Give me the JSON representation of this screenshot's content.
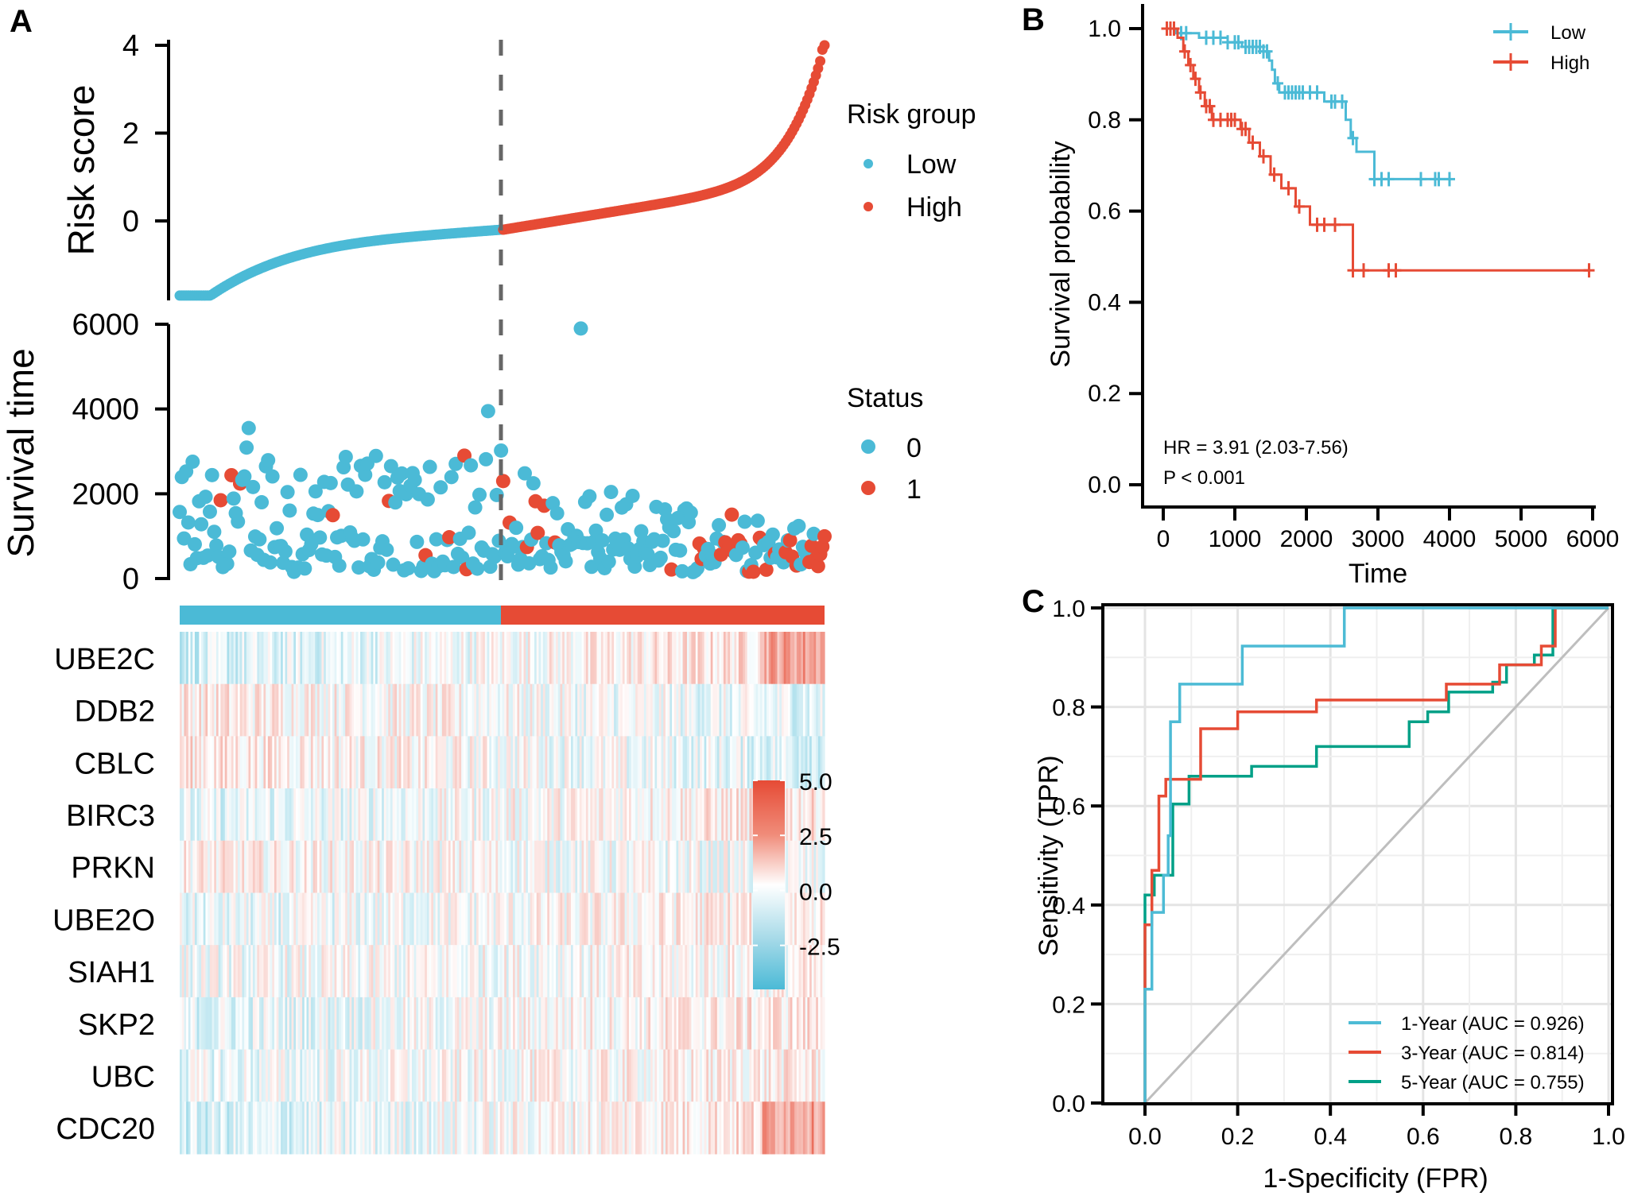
{
  "colors": {
    "low": "#4BBAD6",
    "high": "#E64B35",
    "roc_1y": "#4DBBD5",
    "roc_3y": "#E64B35",
    "roc_5y": "#00A087",
    "diagonal": "#BEBEBE",
    "dashed_cutoff": "#666666"
  },
  "panels": {
    "A": "A",
    "B": "B",
    "C": "C"
  },
  "chart_data": [
    {
      "id": "risk-score",
      "type": "scatter",
      "title": "",
      "ylabel": "Risk score",
      "xlabel": "",
      "ylim": [
        -1.75,
        4.0
      ],
      "yticks": [
        "4",
        "2",
        "0"
      ],
      "ytick_values": [
        4,
        2,
        0
      ],
      "n_patients": 300,
      "cutoff_index": 150,
      "description": "Patients sorted by ascending risk score; low group ranges ~-1.7 to -0.2, high group ranges ~-0.2 to 4.0",
      "series": [
        {
          "name": "Low",
          "x_range": [
            1,
            150
          ],
          "y_start": -1.7,
          "y_end": -0.2
        },
        {
          "name": "High",
          "x_range": [
            151,
            300
          ],
          "y_start": -0.2,
          "y_end": 4.0
        }
      ],
      "legend": {
        "title": "Risk group",
        "entries": [
          "Low",
          "High"
        ],
        "position": "right"
      }
    },
    {
      "id": "survival-time",
      "type": "scatter",
      "ylabel": "Survival time",
      "ylim": [
        0,
        6000
      ],
      "yticks": [
        "6000",
        "4000",
        "2000",
        "0"
      ],
      "ytick_values": [
        6000,
        4000,
        2000,
        0
      ],
      "legend": {
        "title": "Status",
        "entries": [
          "0",
          "1"
        ],
        "position": "right"
      },
      "notable_points": [
        {
          "rank": 186,
          "time": 5900,
          "status": 0
        },
        {
          "rank": 143,
          "time": 3950,
          "status": 0
        },
        {
          "rank": 32,
          "time": 3550,
          "status": 0
        },
        {
          "rank": 132,
          "time": 2900,
          "status": 1
        },
        {
          "rank": 150,
          "time": 2300,
          "status": 1
        }
      ],
      "description": "Survival time per patient ordered by risk score; deaths (status 1) concentrate at the high-risk end"
    },
    {
      "id": "heatmap",
      "type": "heatmap",
      "rows": [
        "UBE2C",
        "DDB2",
        "CBLC",
        "BIRC3",
        "PRKN",
        "UBE2O",
        "SIAH1",
        "SKP2",
        "UBC",
        "CDC20"
      ],
      "row_trend": [
        0.9,
        -0.5,
        -0.6,
        0.6,
        -0.3,
        0.5,
        0.2,
        0.6,
        0.4,
        0.9
      ],
      "annotation_bar": [
        "Low",
        "High"
      ],
      "colorbar": {
        "ticks": [
          "5.0",
          "2.5",
          "0.0",
          "-2.5"
        ],
        "values": [
          5.0,
          2.5,
          0.0,
          -2.5
        ],
        "range": [
          -4.5,
          5.0
        ]
      }
    },
    {
      "id": "km-curve",
      "type": "line",
      "xlabel": "Time",
      "ylabel": "Survival probability",
      "xlim": [
        0,
        6000
      ],
      "ylim": [
        0,
        1.0
      ],
      "xticks": [
        "0",
        "1000",
        "2000",
        "3000",
        "4000",
        "5000",
        "6000"
      ],
      "xtick_values": [
        0,
        1000,
        2000,
        3000,
        4000,
        5000,
        6000
      ],
      "yticks": [
        "1.0",
        "0.8",
        "0.6",
        "0.4",
        "0.2",
        "0.0"
      ],
      "ytick_values": [
        1.0,
        0.8,
        0.6,
        0.4,
        0.2,
        0.0
      ],
      "annotations": [
        "HR = 3.91 (2.03-7.56)",
        "P < 0.001"
      ],
      "legend": {
        "entries": [
          "Low",
          "High"
        ],
        "position": "top-right"
      },
      "series": [
        {
          "name": "Low",
          "steps": [
            [
              0,
              1.0
            ],
            [
              180,
              1.0
            ],
            [
              180,
              0.99
            ],
            [
              500,
              0.99
            ],
            [
              500,
              0.98
            ],
            [
              900,
              0.98
            ],
            [
              900,
              0.97
            ],
            [
              1100,
              0.97
            ],
            [
              1100,
              0.96
            ],
            [
              1400,
              0.96
            ],
            [
              1400,
              0.95
            ],
            [
              1480,
              0.95
            ],
            [
              1480,
              0.93
            ],
            [
              1520,
              0.93
            ],
            [
              1520,
              0.91
            ],
            [
              1560,
              0.91
            ],
            [
              1560,
              0.88
            ],
            [
              1620,
              0.88
            ],
            [
              1620,
              0.86
            ],
            [
              2250,
              0.86
            ],
            [
              2250,
              0.84
            ],
            [
              2550,
              0.84
            ],
            [
              2550,
              0.8
            ],
            [
              2620,
              0.8
            ],
            [
              2620,
              0.76
            ],
            [
              2700,
              0.76
            ],
            [
              2700,
              0.73
            ],
            [
              2950,
              0.73
            ],
            [
              2950,
              0.67
            ],
            [
              4000,
              0.67
            ]
          ],
          "censor_times": [
            250,
            320,
            600,
            700,
            800,
            900,
            1000,
            1050,
            1150,
            1200,
            1250,
            1300,
            1350,
            1400,
            1450,
            1600,
            1700,
            1750,
            1800,
            1850,
            1900,
            1950,
            2050,
            2150,
            2350,
            2400,
            2500,
            2650,
            2950,
            3050,
            3150,
            3600,
            3800,
            3850,
            4000
          ]
        },
        {
          "name": "High",
          "steps": [
            [
              0,
              1.0
            ],
            [
              200,
              1.0
            ],
            [
              200,
              0.98
            ],
            [
              280,
              0.98
            ],
            [
              280,
              0.95
            ],
            [
              350,
              0.95
            ],
            [
              350,
              0.92
            ],
            [
              420,
              0.92
            ],
            [
              420,
              0.89
            ],
            [
              500,
              0.89
            ],
            [
              500,
              0.86
            ],
            [
              580,
              0.86
            ],
            [
              580,
              0.83
            ],
            [
              680,
              0.83
            ],
            [
              680,
              0.8
            ],
            [
              1080,
              0.8
            ],
            [
              1080,
              0.78
            ],
            [
              1200,
              0.78
            ],
            [
              1200,
              0.75
            ],
            [
              1350,
              0.75
            ],
            [
              1350,
              0.72
            ],
            [
              1500,
              0.72
            ],
            [
              1500,
              0.68
            ],
            [
              1650,
              0.68
            ],
            [
              1650,
              0.65
            ],
            [
              1850,
              0.65
            ],
            [
              1850,
              0.61
            ],
            [
              2050,
              0.61
            ],
            [
              2050,
              0.57
            ],
            [
              2650,
              0.57
            ],
            [
              2650,
              0.47
            ],
            [
              5950,
              0.47
            ]
          ],
          "censor_times": [
            50,
            100,
            150,
            300,
            380,
            450,
            520,
            600,
            650,
            700,
            800,
            900,
            950,
            1000,
            1100,
            1150,
            1250,
            1400,
            1550,
            1750,
            1900,
            2150,
            2250,
            2400,
            2650,
            2800,
            3150,
            3250,
            5950
          ]
        }
      ]
    },
    {
      "id": "roc",
      "type": "line",
      "xlabel": "1-Specificity (FPR)",
      "ylabel": "Sensitivity (TPR)",
      "xlim": [
        0,
        1.0
      ],
      "ylim": [
        0,
        1.0
      ],
      "xticks": [
        "0.0",
        "0.2",
        "0.4",
        "0.6",
        "0.8",
        "1.0"
      ],
      "xtick_values": [
        0.0,
        0.2,
        0.4,
        0.6,
        0.8,
        1.0
      ],
      "yticks": [
        "1.0",
        "0.8",
        "0.6",
        "0.4",
        "0.2",
        "0.0"
      ],
      "ytick_values": [
        1.0,
        0.8,
        0.6,
        0.4,
        0.2,
        0.0
      ],
      "grid": true,
      "legend": {
        "position": "bottom-right"
      },
      "series": [
        {
          "name": "1-Year (AUC = 0.926)",
          "label": "1-Year (AUC = 0.926)",
          "auc": 0.926,
          "points": [
            [
              0,
              0
            ],
            [
              0,
              0.23
            ],
            [
              0.015,
              0.23
            ],
            [
              0.015,
              0.385
            ],
            [
              0.04,
              0.385
            ],
            [
              0.04,
              0.46
            ],
            [
              0.05,
              0.46
            ],
            [
              0.05,
              0.54
            ],
            [
              0.055,
              0.54
            ],
            [
              0.055,
              0.77
            ],
            [
              0.075,
              0.77
            ],
            [
              0.075,
              0.846
            ],
            [
              0.21,
              0.846
            ],
            [
              0.21,
              0.923
            ],
            [
              0.43,
              0.923
            ],
            [
              0.43,
              1.0
            ],
            [
              1.0,
              1.0
            ]
          ]
        },
        {
          "name": "3-Year (AUC = 0.814)",
          "label": "3-Year (AUC = 0.814)",
          "auc": 0.814,
          "points": [
            [
              0,
              0
            ],
            [
              0,
              0.36
            ],
            [
              0.015,
              0.36
            ],
            [
              0.015,
              0.47
            ],
            [
              0.03,
              0.47
            ],
            [
              0.03,
              0.62
            ],
            [
              0.045,
              0.62
            ],
            [
              0.045,
              0.654
            ],
            [
              0.12,
              0.654
            ],
            [
              0.12,
              0.756
            ],
            [
              0.2,
              0.756
            ],
            [
              0.2,
              0.79
            ],
            [
              0.37,
              0.79
            ],
            [
              0.37,
              0.814
            ],
            [
              0.65,
              0.814
            ],
            [
              0.65,
              0.846
            ],
            [
              0.765,
              0.846
            ],
            [
              0.765,
              0.885
            ],
            [
              0.855,
              0.885
            ],
            [
              0.855,
              0.923
            ],
            [
              0.885,
              0.923
            ],
            [
              0.885,
              1.0
            ],
            [
              1.0,
              1.0
            ]
          ]
        },
        {
          "name": "5-Year (AUC = 0.755)",
          "label": "5-Year (AUC = 0.755)",
          "auc": 0.755,
          "points": [
            [
              0,
              0
            ],
            [
              0,
              0.42
            ],
            [
              0.02,
              0.42
            ],
            [
              0.02,
              0.46
            ],
            [
              0.06,
              0.46
            ],
            [
              0.06,
              0.604
            ],
            [
              0.095,
              0.604
            ],
            [
              0.095,
              0.66
            ],
            [
              0.23,
              0.66
            ],
            [
              0.23,
              0.68
            ],
            [
              0.37,
              0.68
            ],
            [
              0.37,
              0.72
            ],
            [
              0.57,
              0.72
            ],
            [
              0.57,
              0.77
            ],
            [
              0.61,
              0.77
            ],
            [
              0.61,
              0.79
            ],
            [
              0.655,
              0.79
            ],
            [
              0.655,
              0.83
            ],
            [
              0.75,
              0.83
            ],
            [
              0.75,
              0.85
            ],
            [
              0.78,
              0.85
            ],
            [
              0.78,
              0.885
            ],
            [
              0.84,
              0.885
            ],
            [
              0.84,
              0.905
            ],
            [
              0.88,
              0.905
            ],
            [
              0.88,
              1.0
            ],
            [
              1.0,
              1.0
            ]
          ]
        },
        {
          "name": "reference",
          "points": [
            [
              0,
              0
            ],
            [
              1,
              1
            ]
          ]
        }
      ]
    }
  ]
}
